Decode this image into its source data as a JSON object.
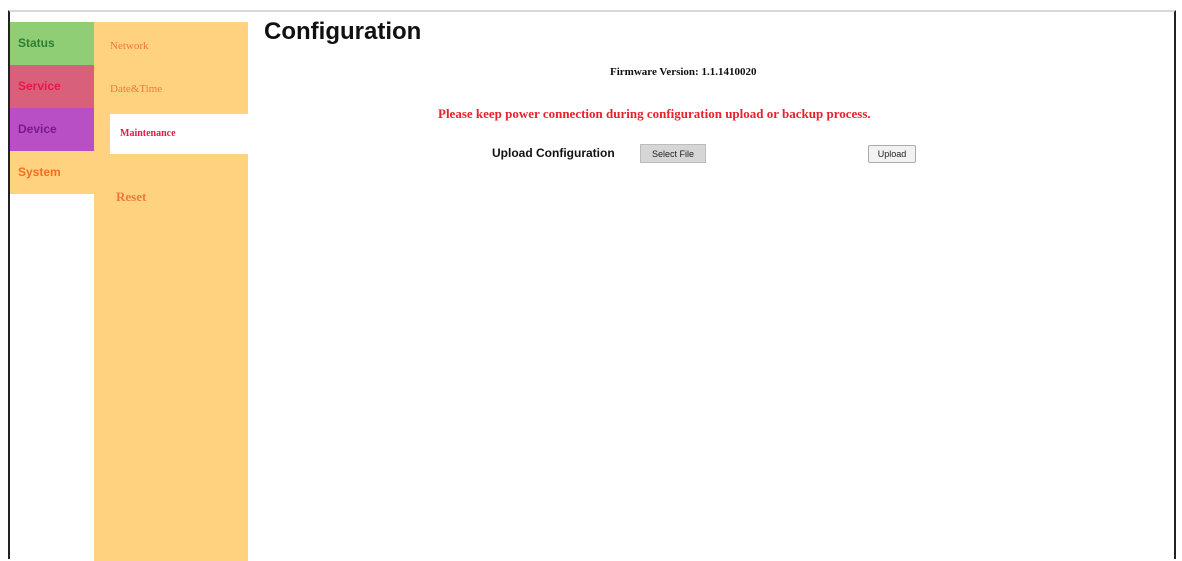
{
  "primary_nav": [
    {
      "label": "Status"
    },
    {
      "label": "Service"
    },
    {
      "label": "Device"
    },
    {
      "label": "System"
    }
  ],
  "secondary_nav": {
    "network": "Network",
    "datetime": "Date&Time",
    "maintenance": "Maintenance",
    "reset": "Reset"
  },
  "main": {
    "title": "Configuration",
    "firmware_label": "Firmware Version:",
    "firmware_value": "1.1.1410020",
    "warning": "Please keep power connection during configuration upload or backup process.",
    "upload_label": "Upload Configuration",
    "select_file_label": "Select File",
    "upload_button_label": "Upload"
  },
  "colors": {
    "status": "#8fce75",
    "service": "#d9607a",
    "device": "#b84fc4",
    "system": "#ffd280",
    "warning": "#e8202f"
  }
}
